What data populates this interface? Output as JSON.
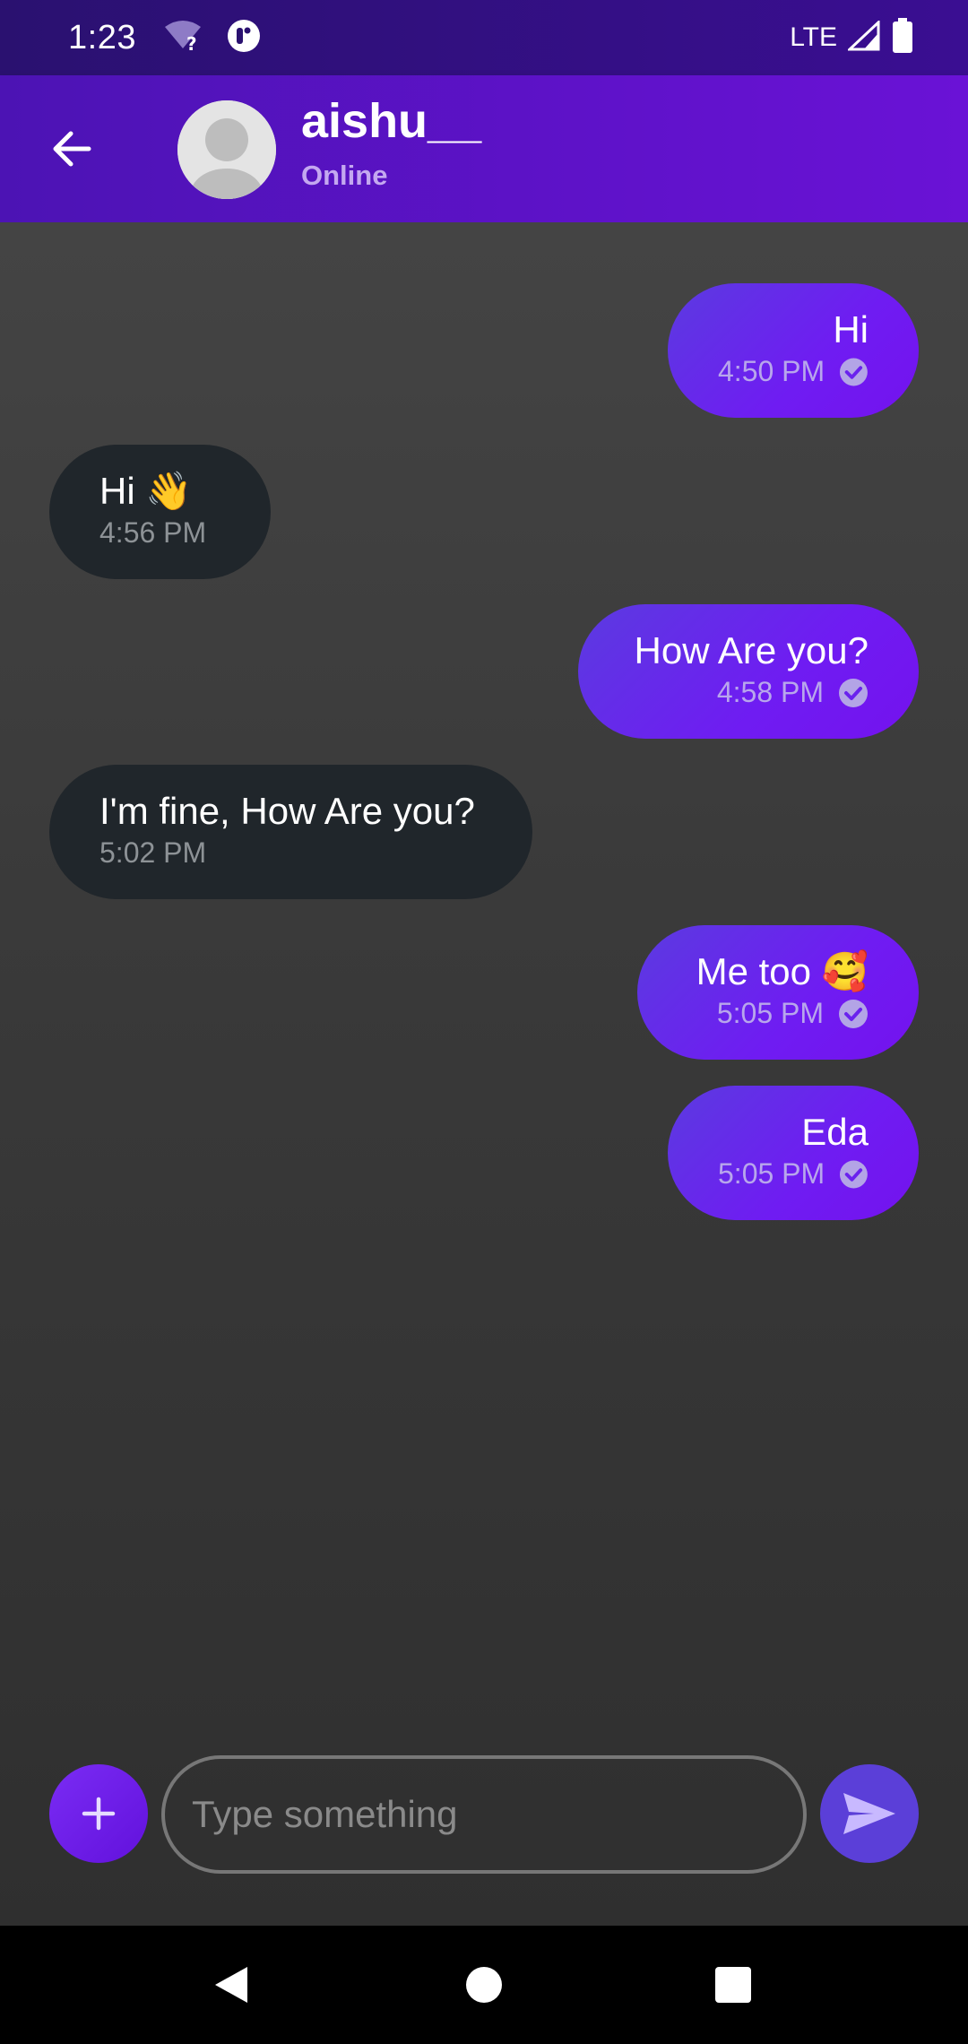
{
  "status_bar": {
    "time": "1:23",
    "network": "LTE",
    "icons": [
      "wifi-unknown-icon",
      "app-notification-icon",
      "signal-icon",
      "battery-icon"
    ]
  },
  "header": {
    "contact_name": "aishu__",
    "contact_status": "Online",
    "icons": [
      "back-arrow-icon",
      "avatar-placeholder"
    ]
  },
  "messages": [
    {
      "direction": "out",
      "text": "Hi",
      "time": "4:50 PM",
      "read": true
    },
    {
      "direction": "in",
      "text": "Hi 👋",
      "time": "4:56 PM"
    },
    {
      "direction": "out",
      "text": "How Are you?",
      "time": "4:58 PM",
      "read": true
    },
    {
      "direction": "in",
      "text": "I'm fine, How Are you?",
      "time": "5:02 PM"
    },
    {
      "direction": "out",
      "text": "Me too 🥰",
      "time": "5:05 PM",
      "read": true
    },
    {
      "direction": "out",
      "text": "Eda",
      "time": "5:05 PM",
      "read": true
    }
  ],
  "composer": {
    "placeholder": "Type something",
    "value": "",
    "icons": [
      "plus-icon",
      "send-icon"
    ]
  },
  "nav": {
    "icons": [
      "back-triangle-icon",
      "home-circle-icon",
      "recents-square-icon"
    ]
  },
  "colors": {
    "status_bar": "#2a1170",
    "app_bar": "#5a12c8",
    "outgoing_bubble": "#6a22ee",
    "incoming_bubble": "#20262b",
    "chat_background": "#3c3c3c",
    "send_button": "#5b3fd8"
  }
}
